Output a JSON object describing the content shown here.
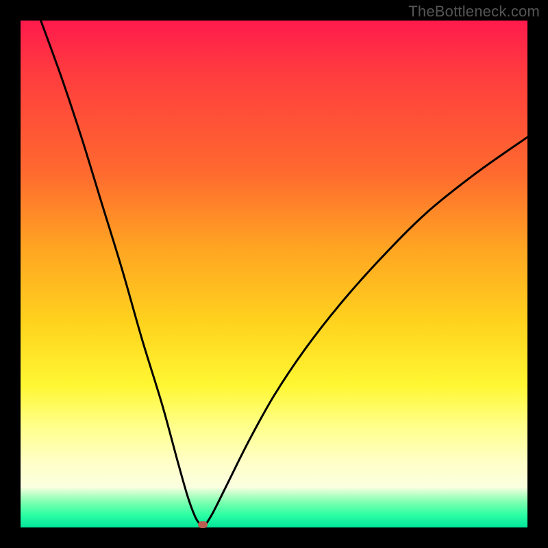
{
  "watermark": "TheBottleneck.com",
  "colors": {
    "frame": "#000000",
    "gradient_top": "#ff1a4d",
    "gradient_mid_orange": "#ffa522",
    "gradient_yellow": "#fff733",
    "gradient_pale": "#ffffc6",
    "gradient_green": "#00e59a",
    "curve": "#000000",
    "marker": "#bb5c52"
  },
  "chart_data": {
    "type": "line",
    "title": "",
    "xlabel": "",
    "ylabel": "",
    "xlim": [
      0,
      100
    ],
    "ylim": [
      0,
      100
    ],
    "grid": false,
    "curve_left": {
      "description": "steep descending branch from top-left toward minimum",
      "x": [
        4,
        8,
        12,
        16,
        20,
        24,
        28,
        31,
        33,
        34.5,
        35.5
      ],
      "y": [
        100,
        89,
        77,
        64,
        51,
        37,
        24,
        13,
        6,
        2,
        0.5
      ]
    },
    "curve_right": {
      "description": "ascending branch from minimum toward upper-right, concave",
      "x": [
        36.5,
        38,
        41,
        45,
        50,
        56,
        63,
        71,
        80,
        90,
        100
      ],
      "y": [
        0.5,
        3,
        9,
        17,
        26,
        35,
        44,
        53,
        62,
        70,
        77
      ]
    },
    "minimum_marker": {
      "x": 36,
      "y": 0.5
    },
    "color_scale_vertical": {
      "description": "background encodes value: top=high(red), bottom=low(green)",
      "stops": [
        {
          "pos": 0,
          "color": "#ff1a4d"
        },
        {
          "pos": 45,
          "color": "#ffa522"
        },
        {
          "pos": 72,
          "color": "#fff733"
        },
        {
          "pos": 92,
          "color": "#fbffe0"
        },
        {
          "pos": 100,
          "color": "#00e59a"
        }
      ]
    }
  }
}
